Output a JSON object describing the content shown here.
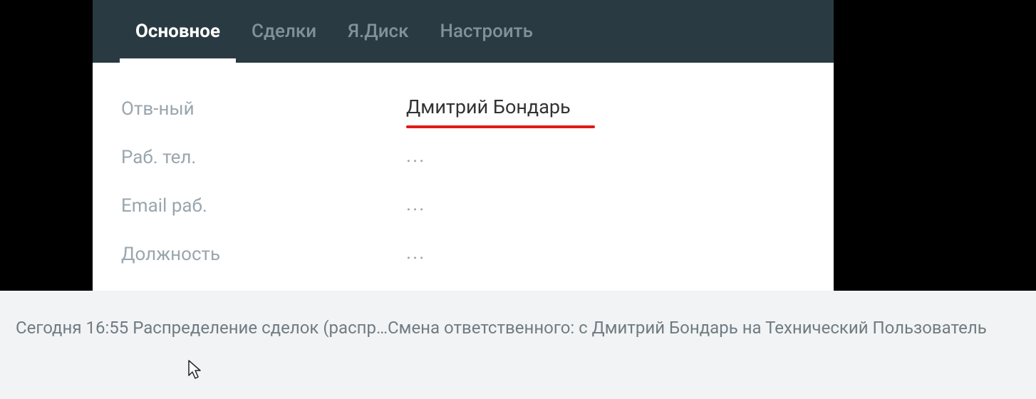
{
  "tabs": [
    {
      "label": "Основное",
      "active": true
    },
    {
      "label": "Сделки",
      "active": false
    },
    {
      "label": "Я.Диск",
      "active": false
    },
    {
      "label": "Настроить",
      "active": false
    }
  ],
  "fields": {
    "responsible": {
      "label": "Отв-ный",
      "value": "Дмитрий Бондарь"
    },
    "work_phone": {
      "label": "Раб. тел.",
      "value": "..."
    },
    "work_email": {
      "label": "Email раб.",
      "value": "..."
    },
    "position": {
      "label": "Должность",
      "value": "..."
    }
  },
  "notification": {
    "time_prefix": "Сегодня 16:55 ",
    "process": "Распределение сделок (распр…",
    "message": "Смена ответственного: с Дмитрий Бондарь на Технический Пользователь"
  }
}
